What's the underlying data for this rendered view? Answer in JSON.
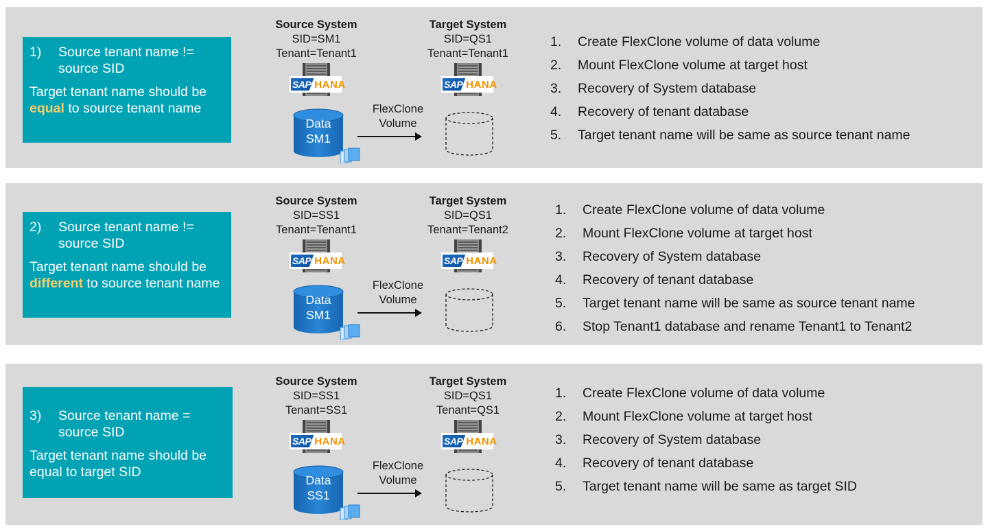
{
  "colors": {
    "panel_bg": "#d9d9d9",
    "scenario_box_bg": "#00a2b4",
    "highlight": "#f6cc6b",
    "sap_blue": "#1d6fc0",
    "hana_orange": "#f39200",
    "db_blue": "#1a6fbf"
  },
  "icons": {
    "server": "server-rack-icon",
    "sap_hana": "sap-hana-logo",
    "source_db": "database-cylinder-icon",
    "snapshot": "snapshot-stack-icon",
    "target_db": "dashed-database-cylinder-icon",
    "arrow": "right-arrow-icon"
  },
  "logo": {
    "sap": "SAP",
    "hana": "HANA"
  },
  "scenarios": [
    {
      "number": "1)",
      "condition": "Source tenant name != source SID",
      "desc_pre": "Target tenant name should be ",
      "desc_highlight": "equal",
      "desc_post": " to source tenant name",
      "source": {
        "title": "Source System",
        "sid": "SID=SM1",
        "tenant": "Tenant=Tenant1",
        "db_line1": "Data",
        "db_line2": "SM1"
      },
      "target": {
        "title": "Target System",
        "sid": "SID=QS1",
        "tenant": "Tenant=Tenant1"
      },
      "flexclone_line1": "FlexClone",
      "flexclone_line2": "Volume",
      "steps": [
        {
          "n": "1.",
          "text": "Create FlexClone volume of data volume"
        },
        {
          "n": "2.",
          "text": "Mount FlexClone volume at target host"
        },
        {
          "n": "3.",
          "text": "Recovery of System database"
        },
        {
          "n": "4.",
          "text": "Recovery of tenant database"
        },
        {
          "n": "5.",
          "text": "Target tenant name will be same as source tenant name"
        }
      ]
    },
    {
      "number": "2)",
      "condition": "Source tenant name != source SID",
      "desc_pre": "Target tenant name should be ",
      "desc_highlight": "different",
      "desc_post": " to source tenant name",
      "source": {
        "title": "Source System",
        "sid": "SID=SS1",
        "tenant": "Tenant=Tenant1",
        "db_line1": "Data",
        "db_line2": "SM1"
      },
      "target": {
        "title": "Target System",
        "sid": "SID=QS1",
        "tenant": "Tenant=Tenant2"
      },
      "flexclone_line1": "FlexClone",
      "flexclone_line2": "Volume",
      "steps": [
        {
          "n": "1.",
          "text": "Create FlexClone volume of data volume"
        },
        {
          "n": "2.",
          "text": "Mount FlexClone volume at target host"
        },
        {
          "n": "3.",
          "text": "Recovery of System database"
        },
        {
          "n": "4.",
          "text": "Recovery of tenant database"
        },
        {
          "n": "5.",
          "text": "Target tenant name will be same as source tenant name"
        },
        {
          "n": "6.",
          "text": "Stop Tenant1 database and rename Tenant1 to Tenant2"
        }
      ]
    },
    {
      "number": "3)",
      "condition": "Source tenant name = source SID",
      "desc_pre": "Target tenant name should be equal to target SID",
      "desc_highlight": "",
      "desc_post": "",
      "source": {
        "title": "Source System",
        "sid": "SID=SS1",
        "tenant": "Tenant=SS1",
        "db_line1": "Data",
        "db_line2": "SS1"
      },
      "target": {
        "title": "Target System",
        "sid": "SID=QS1",
        "tenant": "Tenant=QS1"
      },
      "flexclone_line1": "FlexClone",
      "flexclone_line2": "Volume",
      "steps": [
        {
          "n": "1.",
          "text": "Create FlexClone volume of data volume"
        },
        {
          "n": "2.",
          "text": "Mount FlexClone volume at target host"
        },
        {
          "n": "3.",
          "text": "Recovery of System database"
        },
        {
          "n": "4.",
          "text": "Recovery of tenant database"
        },
        {
          "n": "5.",
          "text": "Target tenant name will be same as target SID"
        }
      ]
    }
  ]
}
